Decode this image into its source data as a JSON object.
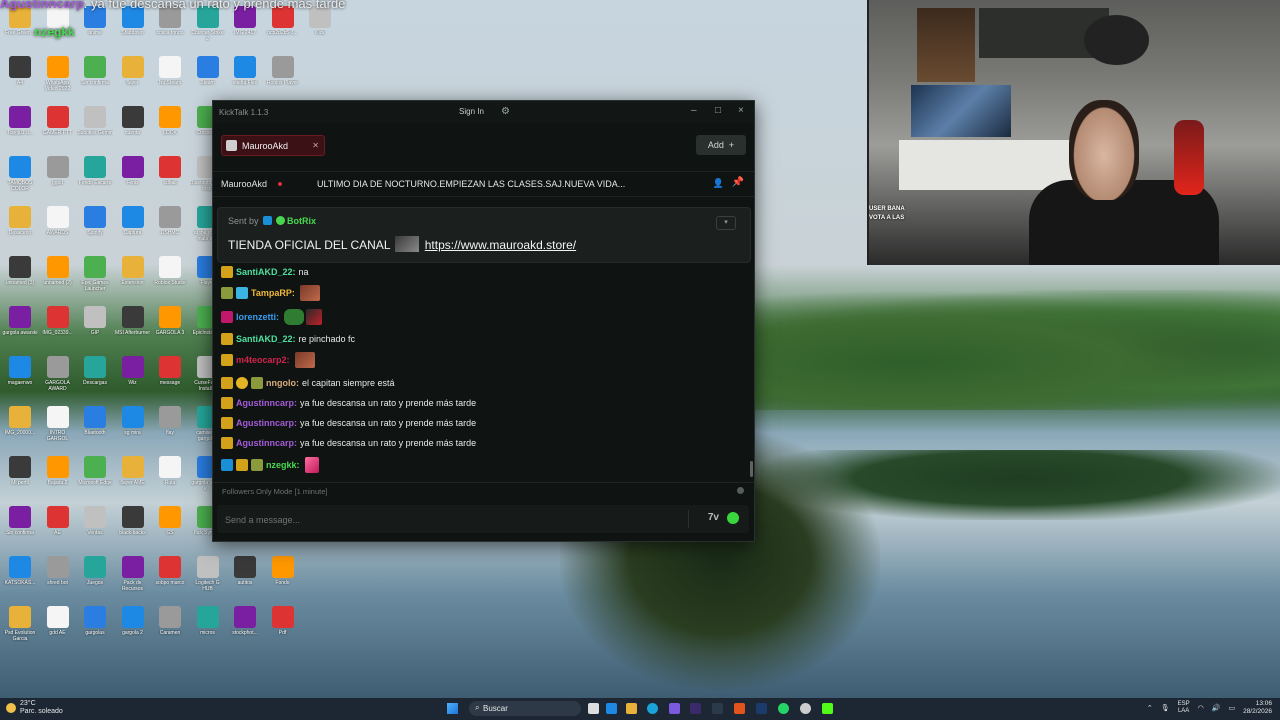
{
  "top_overlay": {
    "user": "Agustinncarp",
    "message": "ya fue descansa un rato y prende más tarde",
    "second_user": "nzegkk"
  },
  "chat_window": {
    "app_name": "KickTalk 1.1.3",
    "sign_in_label": "Sign In",
    "tab_label": "MaurooAkd",
    "add_label": "Add",
    "stream_header": {
      "streamer": "MaurooAkd",
      "title": "ULTIMO DIA DE NOCTURNO.EMPIEZAN LAS CLASES.SAJ.NUEVA VIDA..."
    },
    "pinned": {
      "sent_by_label": "Sent by",
      "bot_name": "BotRix",
      "message_prefix": "TIENDA OFICIAL DEL CANAL",
      "link": "https://www.mauroakd.store/"
    },
    "messages": [
      {
        "user": "SantiAKD_22:",
        "text": "na",
        "color": "#4ee0a0"
      },
      {
        "user": "TampaRP:",
        "text": "",
        "color": "#f0b73a"
      },
      {
        "user": "lorenzetti:",
        "text": "",
        "color": "#3a9cf0"
      },
      {
        "user": "SantiAKD_22:",
        "text": "re pinchado fc",
        "color": "#4ee0a0"
      },
      {
        "user": "m4teocarp2:",
        "text": "",
        "color": "#d0244e"
      },
      {
        "user": "nngolo:",
        "text": "el capitan siempre está",
        "color": "#d9ad7c"
      },
      {
        "user": "Agustinncarp:",
        "text": "ya fue descansa un rato y prende más tarde",
        "color": "#a45bd8"
      },
      {
        "user": "Agustinncarp:",
        "text": "ya fue descansa un rato y prende más tarde",
        "color": "#a45bd8"
      },
      {
        "user": "Agustinncarp:",
        "text": "ya fue descansa un rato y prende más tarde",
        "color": "#a45bd8"
      },
      {
        "user": "nzegkk:",
        "text": "",
        "color": "#48d84f"
      }
    ],
    "followers_mode": "Followers Only Mode [1 minute]",
    "input_placeholder": "Send a message..."
  },
  "webcam_overlay": {
    "line1": "USER BANA",
    "line2": "VOTA A LAS"
  },
  "taskbar": {
    "temperature": "23°C",
    "weather": "Parc. soleado",
    "search_label": "Buscar",
    "lang_top": "ESP",
    "lang_bottom": "LAA",
    "time": "13:06",
    "date": "28/2/2026"
  },
  "desktop_icons": [
    "Free Green...",
    "A4",
    "Topoju1 d...",
    "TAMOBOS COLOR",
    "Desacerio",
    "unnamed (3)",
    "gargola awarski",
    "magaenwo",
    "IMG_20000...",
    "Mi perfil",
    "Sin confirma",
    "KATSOKAS...",
    "Psd Evolution Garcia",
    "Fernet",
    "WhatsApp Video 2022",
    "GAMER PTT",
    "ggod",
    "AWARDS",
    "unnamed (2)",
    "IMG_02339...",
    "GARGOLA AWARD",
    "INTRO GARGOL",
    "Bajada 2",
    "AE",
    "shred bot",
    "gdd AE",
    "anime",
    "Sin confirma",
    "Subtitles Gemin",
    "Fondo Escarte",
    "Spotify",
    "Epic Games Launcher",
    "GIP",
    "Descargas",
    "Bluetooth",
    "Microsoft Edge",
    "Ventas",
    "Juegos",
    "gargolas",
    "Shutdown",
    "flayer",
    "cuenta",
    "Fenix",
    "Captura",
    "Extension",
    "MSI Afterburner",
    "Wiz",
    "sg mira",
    "flayer AME",
    "black-backs",
    "Pack de Recursos",
    "gargola 2",
    "cosita fondo",
    "Nu Steam",
    "LOOK",
    "cdhall",
    "DSHMC",
    "Roblox Studio",
    "GARGOLA 3",
    "message",
    "flay",
    "Ruta",
    "GS",
    "sobpo marco",
    "Caramen",
    "Counter-Strike 2",
    "Steam",
    "Crosswire",
    "Bluetooth Multi-Insta",
    "at the status mala edi.",
    "Flayer",
    "EpicInstalle...",
    "CurseForge Installer",
    "camisetas gargolas",
    "gargola primer e...",
    "flick Symbol",
    "Logitech G HUB",
    "micros",
    "IMG 2417",
    "vuelta Flex",
    "autitos",
    "stockphot...",
    "bcb2d2b5-3...",
    "Roblox Player",
    "Fondo",
    "Pdf",
    "Kick"
  ]
}
